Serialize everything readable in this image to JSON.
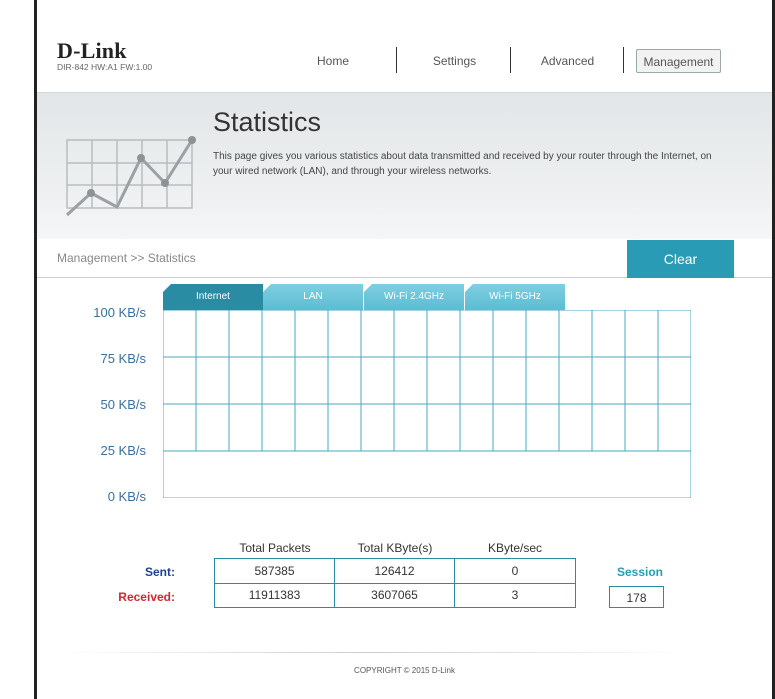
{
  "header": {
    "logo": "D-Link",
    "model_info": "DIR-842   HW:A1   FW:1.00",
    "nav": [
      "Home",
      "Settings",
      "Advanced",
      "Management"
    ],
    "active_nav": "Management"
  },
  "banner": {
    "title": "Statistics",
    "description": "This page gives you various statistics about data transmitted and received by your router through the Internet, on your wired network (LAN), and through your wireless networks."
  },
  "breadcrumb": "Management >> Statistics",
  "clear_label": "Clear",
  "tabs": [
    "Internet",
    "LAN",
    "Wi-Fi 2.4GHz",
    "Wi-Fi 5GHz"
  ],
  "active_tab": "Internet",
  "chart_data": {
    "type": "line",
    "y_tick_labels": [
      "100 KB/s",
      "75 KB/s",
      "50 KB/s",
      "25 KB/s",
      "0 KB/s"
    ],
    "ylim": [
      0,
      100
    ],
    "series": [],
    "grid": true
  },
  "stats": {
    "headers": [
      "Total Packets",
      "Total KByte(s)",
      "KByte/sec"
    ],
    "rows": [
      {
        "label": "Sent:",
        "total_packets": "587385",
        "total_kbytes": "126412",
        "kbyte_sec": "0"
      },
      {
        "label": "Received:",
        "total_packets": "11911383",
        "total_kbytes": "3607065",
        "kbyte_sec": "3"
      }
    ],
    "session_label": "Session",
    "session_value": "178"
  },
  "colors": {
    "accent": "#2a9bb4",
    "sent_label": "#1f3f8f",
    "received_label": "#cc2b2b",
    "grid": "#4aa9c2"
  },
  "footer": "COPYRIGHT © 2015 D-Link"
}
